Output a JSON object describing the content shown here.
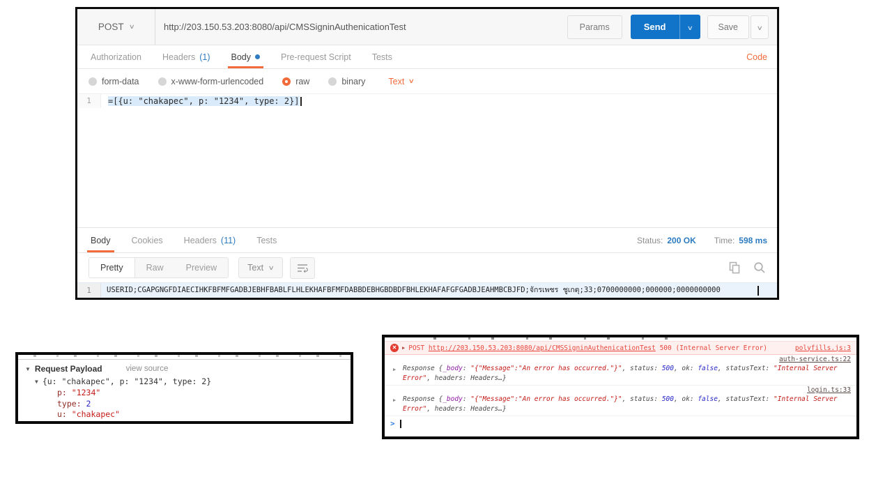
{
  "icons": {
    "chevron_down": "∨",
    "triangle_down": "▼",
    "triangle_right": "▶",
    "error_x": "✕",
    "prompt": ">"
  },
  "postman": {
    "method": "POST",
    "url": "http://203.150.53.203:8080/api/CMSSigninAuthenicationTest",
    "params_label": "Params",
    "send_label": "Send",
    "save_label": "Save",
    "code_link": "Code",
    "request_tabs": [
      {
        "label": "Authorization",
        "active": false
      },
      {
        "label": "Headers",
        "count": "(1)",
        "active": false
      },
      {
        "label": "Body",
        "dot": true,
        "active": true
      },
      {
        "label": "Pre-request Script",
        "active": false
      },
      {
        "label": "Tests",
        "active": false
      }
    ],
    "body_types": [
      {
        "label": "form-data",
        "selected": false
      },
      {
        "label": "x-www-form-urlencoded",
        "selected": false
      },
      {
        "label": "raw",
        "selected": true
      },
      {
        "label": "binary",
        "selected": false
      }
    ],
    "raw_type": "Text",
    "editor": {
      "line_number": "1",
      "code": "=[{u: \"chakapec\", p: \"1234\", type: 2}]"
    },
    "response": {
      "tabs": [
        {
          "label": "Body",
          "active": true
        },
        {
          "label": "Cookies",
          "active": false
        },
        {
          "label": "Headers",
          "count": "(11)",
          "active": false
        },
        {
          "label": "Tests",
          "active": false
        }
      ],
      "status_label": "Status:",
      "status_value": "200 OK",
      "time_label": "Time:",
      "time_value": "598 ms",
      "view_modes": [
        {
          "label": "Pretty",
          "active": true
        },
        {
          "label": "Raw",
          "active": false
        },
        {
          "label": "Preview",
          "active": false
        }
      ],
      "format": "Text",
      "body_line_number": "1",
      "body": "USERID;CGAPGNGFDIAECIHKFBFMFGADBJEBHFBABLFLHLEKHAFBFMFDABBDEBHGBDBDFBHLEKHAFAFGFGADBJEAHMBCBJFD;จักรเพชร ชูเกตุ;33;0700000000;000000;0000000000"
    }
  },
  "payload_panel": {
    "title": "Request Payload",
    "view_source": "view source",
    "preview": "{u: \"chakapec\", p: \"1234\", type: 2}",
    "rows": [
      {
        "key": "p: ",
        "value": "\"1234\"",
        "vtype": "str"
      },
      {
        "key": "type: ",
        "value": "2",
        "vtype": "num"
      },
      {
        "key": "u: ",
        "value": "\"chakapec\"",
        "vtype": "str"
      }
    ]
  },
  "console_panel": {
    "error": {
      "prefix": "POST ",
      "url": "http://203.150.53.203:8080/api/CMSSigninAuthenicationTest",
      "suffix": " 500 (Internal Server Error)",
      "source": "polyfills.js:3"
    },
    "entries": [
      {
        "source": "auth-service.ts:22",
        "segments": [
          {
            "t": "Response {",
            "c": "plain"
          },
          {
            "t": "_body",
            "c": "key"
          },
          {
            "t": ": ",
            "c": "plain"
          },
          {
            "t": "\"{\"Message\":\"An error has occurred.\"}\"",
            "c": "str"
          },
          {
            "t": ", status: ",
            "c": "plain"
          },
          {
            "t": "500",
            "c": "num"
          },
          {
            "t": ", ok: ",
            "c": "plain"
          },
          {
            "t": "false",
            "c": "num"
          },
          {
            "t": ", statusText: ",
            "c": "plain"
          },
          {
            "t": "\"Internal Server Error\"",
            "c": "str"
          },
          {
            "t": ", headers: Headers…}",
            "c": "plain"
          }
        ]
      },
      {
        "source": "login.ts:33",
        "segments": [
          {
            "t": "Response {",
            "c": "plain"
          },
          {
            "t": "_body",
            "c": "key"
          },
          {
            "t": ": ",
            "c": "plain"
          },
          {
            "t": "\"{\"Message\":\"An error has occurred.\"}\"",
            "c": "str"
          },
          {
            "t": ", status: ",
            "c": "plain"
          },
          {
            "t": "500",
            "c": "num"
          },
          {
            "t": ", ok: ",
            "c": "plain"
          },
          {
            "t": "false",
            "c": "num"
          },
          {
            "t": ", statusText: ",
            "c": "plain"
          },
          {
            "t": "\"Internal Server Error\"",
            "c": "str"
          },
          {
            "t": ", headers: Headers…}",
            "c": "plain"
          }
        ]
      }
    ]
  }
}
